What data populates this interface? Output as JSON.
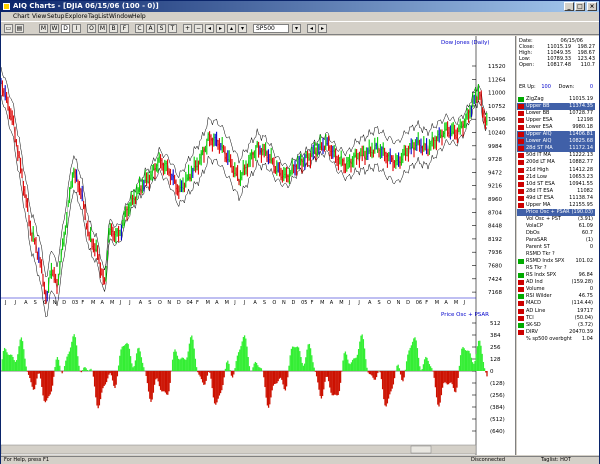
{
  "window": {
    "title": "AIQ Charts - [DJIA 06/15/06 (100 - 0)]",
    "min_glyph": "_",
    "max_glyph": "□",
    "close_glyph": "×",
    "title_color": "#0a246a"
  },
  "menu": [
    "Chart",
    "View",
    "Setup",
    "Explore",
    "TagList",
    "Window",
    "Help"
  ],
  "toolbar": {
    "buttons": [
      "M",
      "W",
      "D",
      "I",
      "O",
      "M",
      "B",
      "F",
      "C",
      "A",
      "S",
      "T"
    ],
    "symbol": "SP500"
  },
  "chart": {
    "price_title": "Dow Jones (Daily)",
    "osc_title": "Price Osc + PSAR",
    "price_ticks": [
      "11520",
      "11264",
      "11000",
      "10752",
      "10496",
      "10240",
      "9984",
      "9728",
      "9472",
      "9216",
      "8960",
      "8704",
      "8448",
      "8192",
      "7936",
      "7680",
      "7424",
      "7168"
    ],
    "osc_ticks": [
      "512",
      "384",
      "256",
      "128",
      "0",
      "(128)",
      "(256)",
      "(384)",
      "(512)",
      "(640)"
    ],
    "months": [
      "J",
      "J",
      "A",
      "S",
      "O",
      "N",
      "D",
      "03",
      "F",
      "M",
      "A",
      "M",
      "J",
      "J",
      "A",
      "S",
      "O",
      "N",
      "D",
      "04",
      "F",
      "M",
      "A",
      "M",
      "J",
      "J",
      "A",
      "S",
      "O",
      "N",
      "D",
      "05",
      "F",
      "M",
      "A",
      "M",
      "J",
      "J",
      "A",
      "S",
      "O",
      "N",
      "D",
      "06",
      "F",
      "M",
      "A",
      "M",
      "J"
    ],
    "colors": {
      "up": "#00cc00",
      "down": "#dd0000",
      "neutral": "#0000cc",
      "band": "#000000",
      "osc_up": "#33ee33",
      "osc_down": "#cc1100"
    }
  },
  "quote": {
    "date_label": "Date:",
    "date": "06/15/06",
    "rows": [
      {
        "k": "Close:",
        "v": "11015.19",
        "c": "198.27"
      },
      {
        "k": "High:",
        "v": "11049.35",
        "c": "198.67"
      },
      {
        "k": "Low:",
        "v": "10789.33",
        "c": "123.43"
      },
      {
        "k": "Open:",
        "v": "10817.48",
        "c": "110.7"
      }
    ],
    "er_label": "ER Up:",
    "er_up": "100",
    "er_down_label": "Down:",
    "er_down": "0"
  },
  "indicators": [
    {
      "label": "ZigZag",
      "value": "11015.19",
      "mark": "up",
      "hl": false
    },
    {
      "label": "Upper BB",
      "value": "11374.35",
      "mark": "down",
      "hl": true
    },
    {
      "label": "Lower BB",
      "value": "10728.77",
      "mark": "down",
      "hl": false
    },
    {
      "label": "Upper ESA",
      "value": "12198",
      "mark": "down",
      "hl": false
    },
    {
      "label": "Lower ESA",
      "value": "9980.18",
      "mark": "down",
      "hl": false
    },
    {
      "label": "Upper AIQ",
      "value": "11406.81",
      "mark": "down",
      "hl": true
    },
    {
      "label": "Lower AIQ",
      "value": "10825.68",
      "mark": "down",
      "hl": true
    },
    {
      "label": "28d ST MA",
      "value": "11172.14",
      "mark": "down",
      "hl": true
    },
    {
      "label": "50d IT MA",
      "value": "11222.13",
      "mark": "down",
      "hl": false
    },
    {
      "label": "200d LT MA",
      "value": "10882.77",
      "mark": "down",
      "hl": false
    },
    {
      "label": "21d High",
      "value": "11412.28",
      "mark": "down",
      "hl": false
    },
    {
      "label": "21d Low",
      "value": "10653.23",
      "mark": "down",
      "hl": false
    },
    {
      "label": "10d ST ESA",
      "value": "10941.55",
      "mark": "down",
      "hl": false
    },
    {
      "label": "28d IT ESA",
      "value": "11082",
      "mark": "down",
      "hl": false
    },
    {
      "label": "49d LT ESA",
      "value": "11138.74",
      "mark": "down",
      "hl": false
    },
    {
      "label": "Upper MA",
      "value": "12155.95",
      "mark": "down",
      "hl": false
    },
    {
      "label": "Price Osc + PSAR",
      "value": "(190.03)",
      "mark": "none",
      "hl": true
    },
    {
      "label": "Vol Osc + PST",
      "value": "(3.91)",
      "mark": "none",
      "hl": false
    },
    {
      "label": "VolaCP",
      "value": "61.09",
      "mark": "none",
      "hl": false
    },
    {
      "label": "DbOs",
      "value": "60.7",
      "mark": "none",
      "hl": false
    },
    {
      "label": "ParaSAR",
      "value": "(1)",
      "mark": "none",
      "hl": false
    },
    {
      "label": "Parent ST",
      "value": "0",
      "mark": "none",
      "hl": false
    },
    {
      "label": "RSMD Tkr ?",
      "value": "",
      "mark": "none",
      "hl": false
    },
    {
      "label": "RSMD Indx SPX",
      "value": "101.02",
      "mark": "up",
      "hl": false
    },
    {
      "label": "RS Tkr ?",
      "value": "",
      "mark": "none",
      "hl": false
    },
    {
      "label": "RS Indx SPX",
      "value": "96.84",
      "mark": "up",
      "hl": false
    },
    {
      "label": "AD Ind",
      "value": "(159.28)",
      "mark": "down",
      "hl": false
    },
    {
      "label": "Volume",
      "value": "0",
      "mark": "down",
      "hl": false
    },
    {
      "label": "RSI Wilder",
      "value": "46.75",
      "mark": "up",
      "hl": false
    },
    {
      "label": "MACD",
      "value": "(114.44)",
      "mark": "down",
      "hl": false
    },
    {
      "label": "AD Line",
      "value": "19717",
      "mark": "down",
      "hl": false
    },
    {
      "label": "TCI",
      "value": "(50.04)",
      "mark": "down",
      "hl": false
    },
    {
      "label": "SK-SD",
      "value": "(3.72)",
      "mark": "up",
      "hl": false
    },
    {
      "label": "DIRV",
      "value": "20470.39",
      "mark": "down",
      "hl": false
    },
    {
      "label": "% sp500 overbght",
      "value": "1.04",
      "mark": "none",
      "hl": false
    }
  ],
  "status": {
    "help": "For Help, press F1",
    "conn": "Disconnected",
    "tag": "Taglist: HOT"
  }
}
